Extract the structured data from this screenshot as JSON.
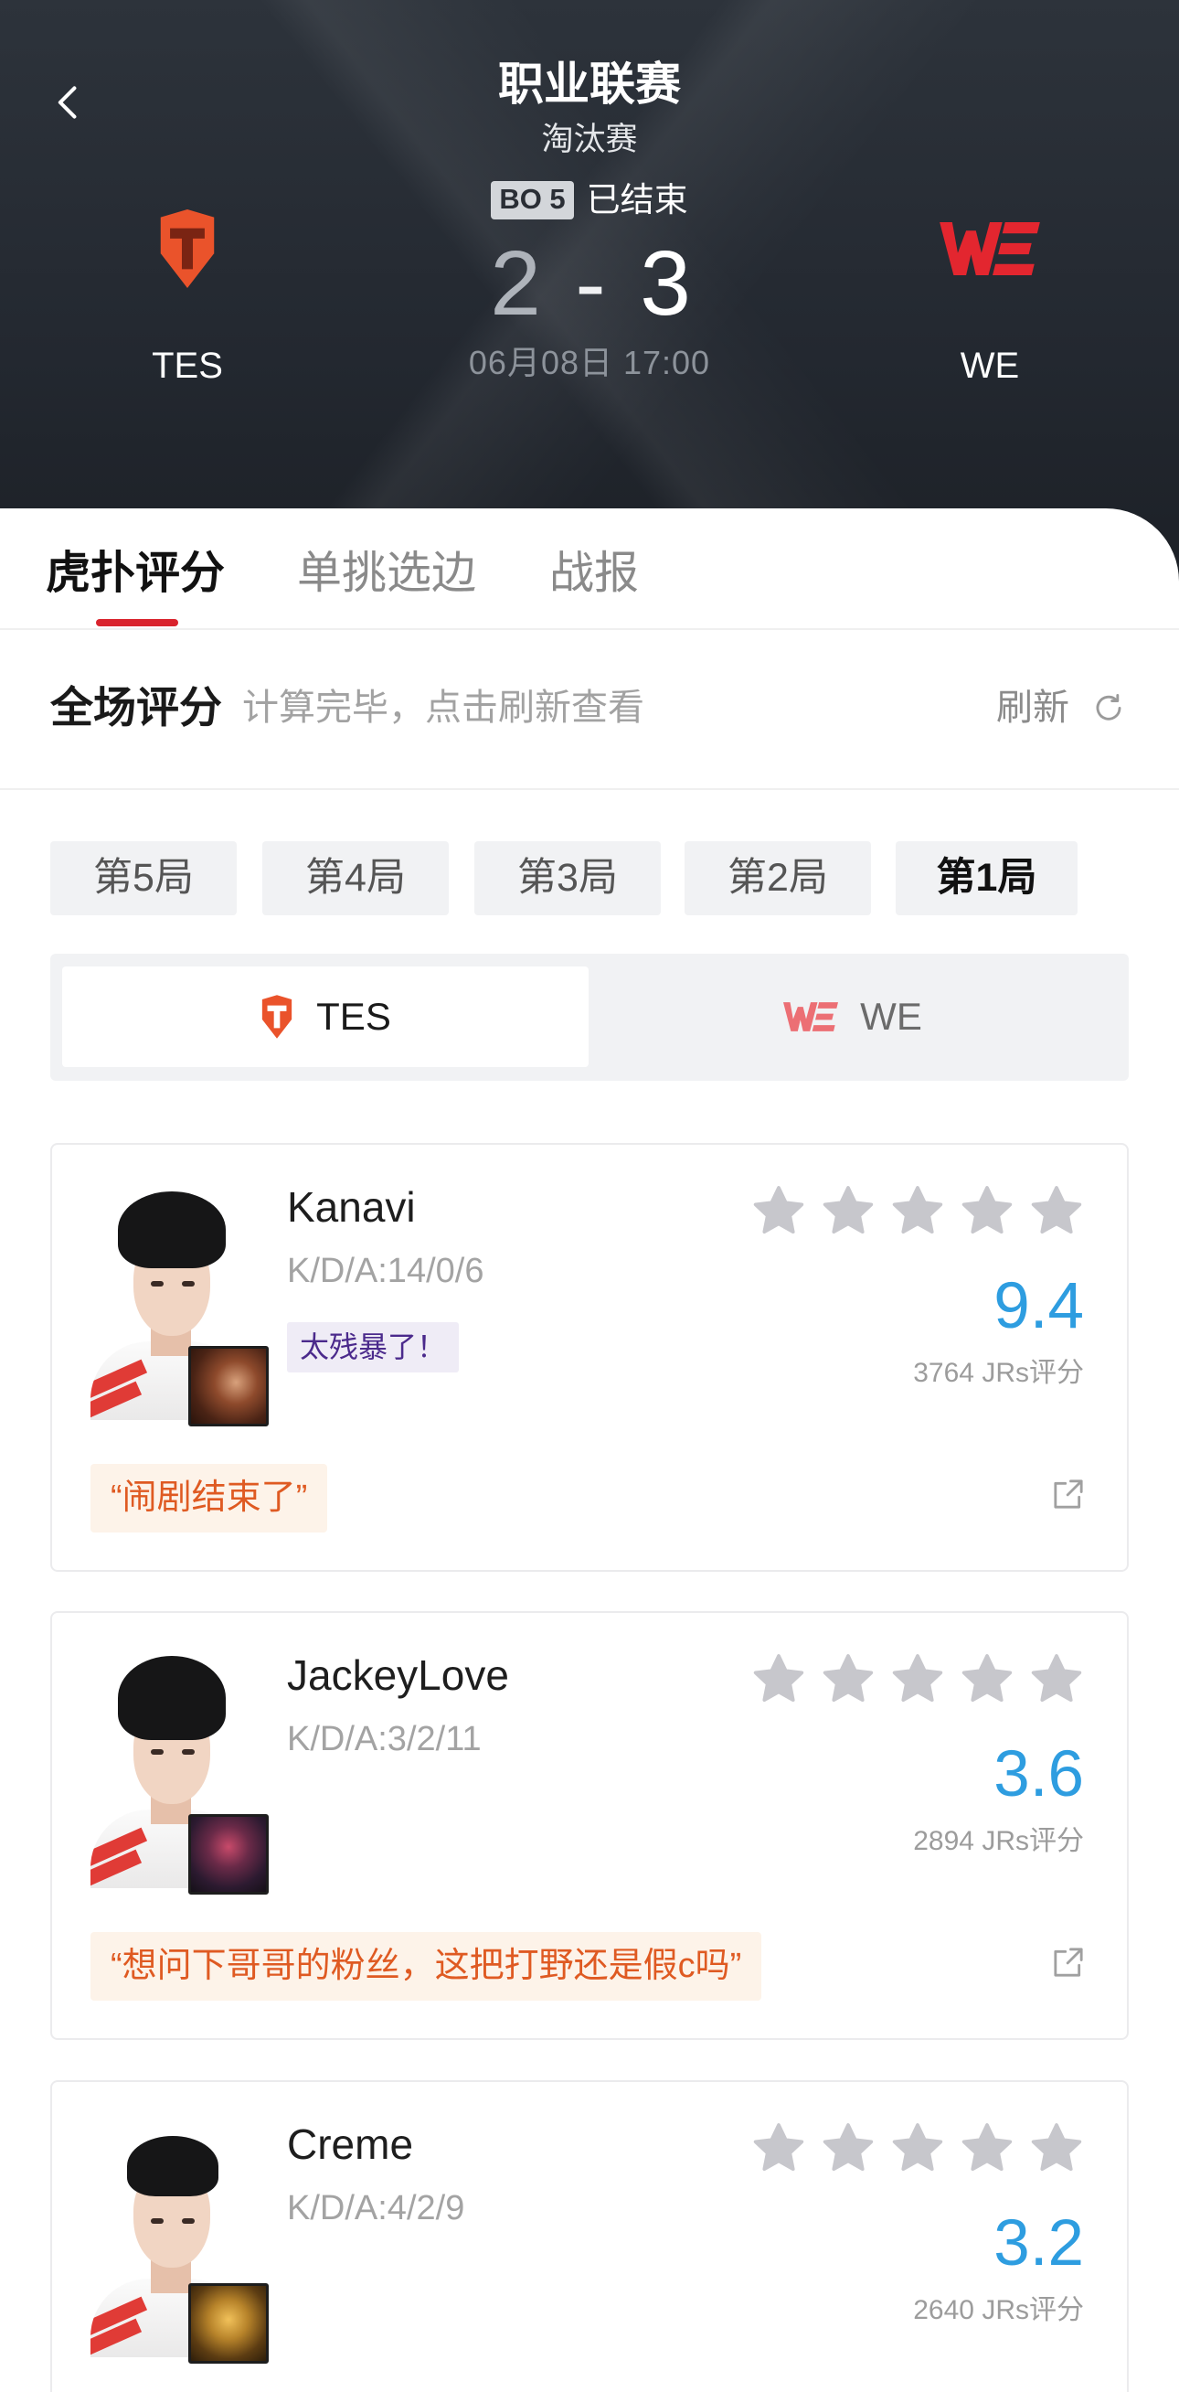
{
  "theme": {
    "accent_red": "#d9232d",
    "rating_blue": "#2e9de0",
    "comment_orange": "#df5a22",
    "comment_bg": "#fdf3e9",
    "tag_purple": "#4b2a8c",
    "header_bg": "#232830",
    "tes_orange": "#ea532b",
    "we_red": "#e3262f",
    "star_gray": "#c7c7cc"
  },
  "header": {
    "back_icon": "chevron-left-icon",
    "title": "职业联赛",
    "subtitle": "淘汰赛",
    "format_badge": "BO 5",
    "status": "已结束",
    "score_separator": "-",
    "datetime": "06月08日 17:00",
    "home": {
      "name": "TES",
      "score": "2",
      "logo": "tes-logo"
    },
    "away": {
      "name": "WE",
      "score": "3",
      "logo": "we-logo",
      "logo_lettering": "WE"
    }
  },
  "tabs": [
    {
      "label": "虎扑评分",
      "active": true
    },
    {
      "label": "单挑选边",
      "active": false
    },
    {
      "label": "战报",
      "active": false
    }
  ],
  "rating_section": {
    "title": "全场评分",
    "hint": "计算完毕，点击刷新查看",
    "refresh_label": "刷新",
    "refresh_icon": "refresh-icon"
  },
  "games": [
    {
      "label": "第5局",
      "active": false
    },
    {
      "label": "第4局",
      "active": false
    },
    {
      "label": "第3局",
      "active": false
    },
    {
      "label": "第2局",
      "active": false
    },
    {
      "label": "第1局",
      "active": true
    }
  ],
  "team_toggle": [
    {
      "name": "TES",
      "logo": "tes-logo",
      "active": true
    },
    {
      "name": "WE",
      "logo": "we-logo",
      "active": false
    }
  ],
  "players": [
    {
      "name": "Kanavi",
      "kda": "K/D/A:14/0/6",
      "tag": "太残暴了！",
      "user_stars": 0,
      "max_stars": 5,
      "rating": "9.4",
      "votes": "3764 JRs评分",
      "comment": "“闹剧结束了”",
      "champion_icon": "champion-icon",
      "share_icon": "share-icon"
    },
    {
      "name": "JackeyLove",
      "kda": "K/D/A:3/2/11",
      "user_stars": 0,
      "max_stars": 5,
      "rating": "3.6",
      "votes": "2894 JRs评分",
      "comment": "“想问下哥哥的粉丝，这把打野还是假c吗”",
      "champion_icon": "champion-icon",
      "share_icon": "share-icon"
    },
    {
      "name": "Creme",
      "kda": "K/D/A:4/2/9",
      "user_stars": 0,
      "max_stars": 5,
      "rating": "3.2",
      "votes": "2640 JRs评分",
      "champion_icon": "champion-icon"
    }
  ]
}
